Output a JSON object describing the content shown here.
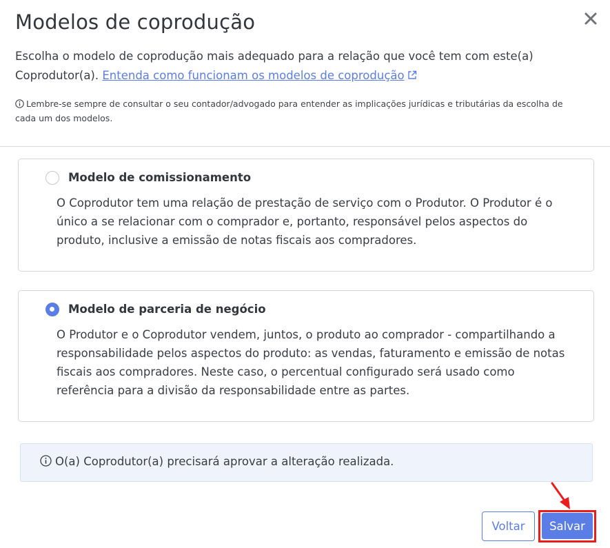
{
  "modal": {
    "title": "Modelos de coprodução",
    "intro_text": "Escolha o modelo de coprodução mais adequado para a relação que você tem com este(a) Coprodutor(a).",
    "intro_link": "Entenda como funcionam os modelos de coprodução",
    "note": "Lembre-se sempre de consultar o seu contador/advogado para entender as implicações jurídicas e tributárias da escolha de cada um dos modelos."
  },
  "options": [
    {
      "title": "Modelo de comissionamento",
      "description": "O Coprodutor tem uma relação de prestação de serviço com o Produtor. O Produtor é o único a se relacionar com o comprador e, portanto, responsável pelos aspectos do produto, inclusive a emissão de notas fiscais aos compradores.",
      "selected": false
    },
    {
      "title": "Modelo de parceria de negócio",
      "description": "O Produtor e o Coprodutor vendem, juntos, o produto ao comprador - compartilhando a responsabilidade pelos aspectos do produto: as vendas, faturamento e emissão de notas fiscais aos compradores. Neste caso, o percentual configurado será usado como referência para a divisão da responsabilidade entre as partes.",
      "selected": true
    }
  ],
  "alert": {
    "text": "O(a) Coprodutor(a) precisará aprovar a alteração realizada."
  },
  "buttons": {
    "back_label": "Voltar",
    "save_label": "Salvar"
  },
  "icons": {
    "close": "close-icon",
    "external_link": "external-link-icon",
    "info": "info-icon",
    "annotation": "red-arrow-icon"
  },
  "colors": {
    "accent": "#5b7ee6",
    "highlight": "#ea1c1c",
    "alert_bg": "#eef3fc"
  }
}
